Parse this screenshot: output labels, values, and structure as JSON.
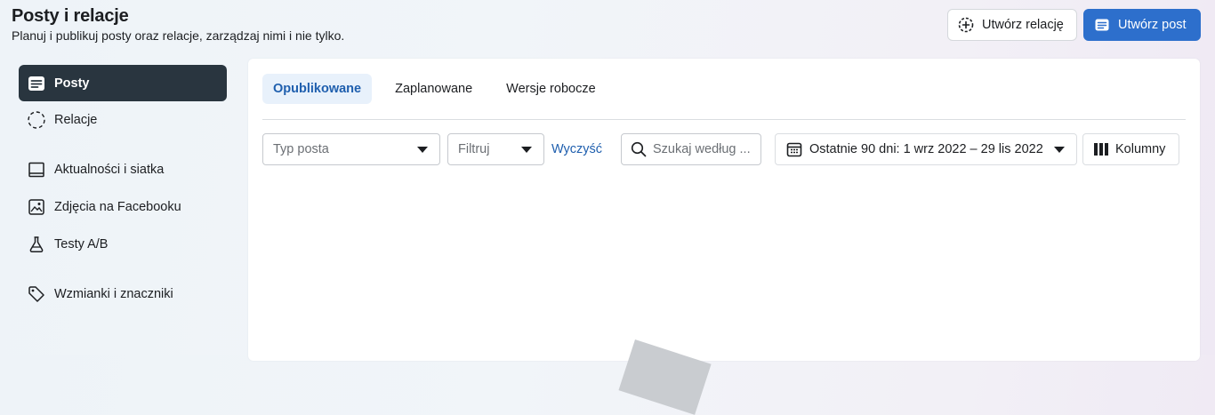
{
  "header": {
    "title": "Posty i relacje",
    "subtitle": "Planuj i publikuj posty oraz relacje, zarządzaj nimi i nie tylko."
  },
  "actions": {
    "create_story": "Utwórz relację",
    "create_post": "Utwórz post"
  },
  "sidebar": {
    "items": [
      {
        "label": "Posty",
        "icon": "post-icon",
        "active": true
      },
      {
        "label": "Relacje",
        "icon": "story-ring-icon"
      },
      {
        "label": "Aktualności i siatka",
        "icon": "feed-grid-icon"
      },
      {
        "label": "Zdjęcia na Facebooku",
        "icon": "photos-icon"
      },
      {
        "label": "Testy A/B",
        "icon": "flask-icon"
      },
      {
        "label": "Wzmianki i znaczniki",
        "icon": "tag-icon"
      }
    ]
  },
  "tabs": [
    {
      "label": "Opublikowane",
      "active": true
    },
    {
      "label": "Zaplanowane"
    },
    {
      "label": "Wersje robocze"
    }
  ],
  "filters": {
    "post_type_placeholder": "Typ posta",
    "filter_placeholder": "Filtruj",
    "clear": "Wyczyść",
    "search_placeholder": "Szukaj według ...",
    "date_range": "Ostatnie 90 dni: 1 wrz 2022 – 29 lis 2022",
    "columns": "Kolumny"
  },
  "colors": {
    "accent": "#2d6fcc",
    "active_sidebar": "#29353f",
    "active_tab_bg": "#e8f1fb",
    "link": "#1f5fae"
  }
}
